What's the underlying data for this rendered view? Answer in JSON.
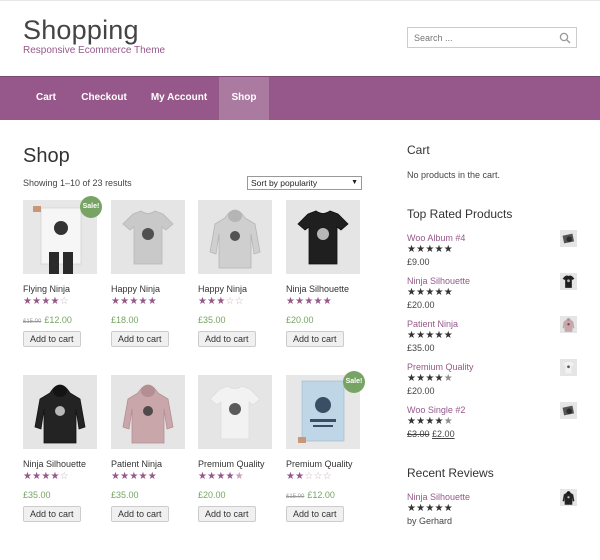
{
  "header": {
    "site_title": "Shopping",
    "tagline": "Responsive Ecommerce Theme",
    "search_placeholder": "Search ...",
    "accent_color": "#96588a"
  },
  "nav": {
    "items": [
      {
        "label": "Cart"
      },
      {
        "label": "Checkout"
      },
      {
        "label": "My Account"
      },
      {
        "label": "Shop",
        "active": true
      }
    ]
  },
  "shop": {
    "title": "Shop",
    "result_count": "Showing 1–10 of 23 results",
    "sort_selected": "Sort by popularity",
    "products": [
      {
        "name": "Flying Ninja",
        "rating": 4,
        "old_price": "£15.00",
        "price": "£12.00",
        "sale_label": "Sale!",
        "button": "Add to cart",
        "image": "poster-ninja"
      },
      {
        "name": "Happy Ninja",
        "rating": 5,
        "price": "£18.00",
        "button": "Add to cart",
        "image": "tshirt-grey"
      },
      {
        "name": "Happy Ninja",
        "rating": 3,
        "price": "£35.00",
        "button": "Add to cart",
        "image": "hoodie-grey"
      },
      {
        "name": "Ninja Silhouette",
        "rating": 5,
        "price": "£20.00",
        "button": "Add to cart",
        "image": "tshirt-black"
      },
      {
        "name": "Ninja Silhouette",
        "rating": 4,
        "price": "£35.00",
        "button": "Add to cart",
        "image": "hoodie-black"
      },
      {
        "name": "Patient Ninja",
        "rating": 5,
        "price": "£35.00",
        "button": "Add to cart",
        "image": "hoodie-pink"
      },
      {
        "name": "Premium Quality",
        "rating": 4.5,
        "price": "£20.00",
        "button": "Add to cart",
        "image": "tshirt-white"
      },
      {
        "name": "Premium Quality",
        "rating": 2,
        "old_price": "£15.00",
        "price": "£12.00",
        "sale_label": "Sale!",
        "button": "Add to cart",
        "image": "poster-blue"
      }
    ]
  },
  "sidebar": {
    "cart_title": "Cart",
    "cart_empty": "No products in the cart.",
    "top_rated_title": "Top Rated Products",
    "top_rated": [
      {
        "name": "Woo Album #4",
        "rating": 5,
        "price": "£9.00",
        "thumb": "album"
      },
      {
        "name": "Ninja Silhouette",
        "rating": 5,
        "price": "£20.00",
        "thumb": "tshirt-black"
      },
      {
        "name": "Patient Ninja",
        "rating": 5,
        "price": "£35.00",
        "thumb": "hoodie-pink"
      },
      {
        "name": "Premium Quality",
        "rating": 4.5,
        "price": "£20.00",
        "thumb": "tshirt-white"
      },
      {
        "name": "Woo Single #2",
        "rating": 4.5,
        "old_price": "£3.00",
        "price": "£2.00",
        "thumb": "album"
      }
    ],
    "reviews_title": "Recent Reviews",
    "reviews": [
      {
        "name": "Ninja Silhouette",
        "rating": 5,
        "by": "by Gerhard",
        "thumb": "hoodie-black"
      }
    ]
  }
}
